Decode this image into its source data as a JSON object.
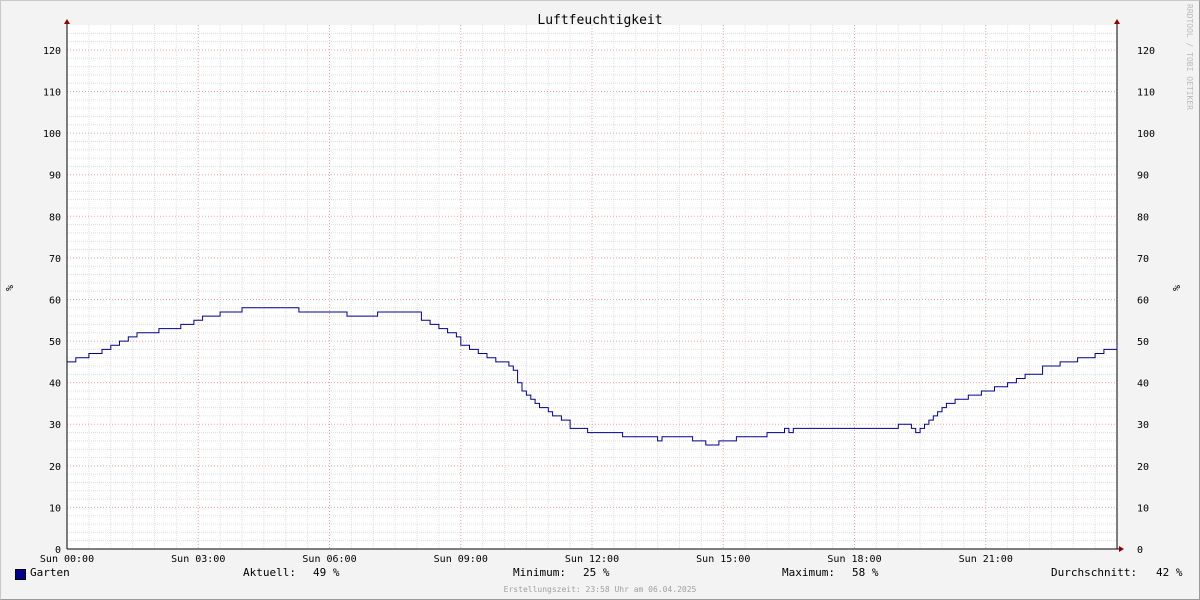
{
  "chart_data": {
    "type": "line",
    "title": "Luftfeuchtigkeit",
    "ylabel": "%",
    "ylim": [
      0,
      126
    ],
    "y_ticks": [
      0,
      10,
      20,
      30,
      40,
      50,
      60,
      70,
      80,
      90,
      100,
      110,
      120
    ],
    "x_range_hours": [
      0,
      24
    ],
    "x_tick_labels": [
      "Sun 00:00",
      "Sun 03:00",
      "Sun 06:00",
      "Sun 09:00",
      "Sun 12:00",
      "Sun 15:00",
      "Sun 18:00",
      "Sun 21:00"
    ],
    "grid": true,
    "series": [
      {
        "name": "Garten",
        "color": "#00008b",
        "hours": [
          0,
          0.2,
          0.5,
          0.8,
          1.0,
          1.2,
          1.4,
          1.6,
          1.8,
          2.1,
          2.6,
          2.9,
          3.1,
          3.5,
          3.8,
          4.0,
          5.3,
          6.4,
          7.1,
          8.0,
          8.1,
          8.3,
          8.5,
          8.7,
          8.9,
          9.0,
          9.2,
          9.4,
          9.6,
          9.8,
          10.1,
          10.2,
          10.3,
          10.4,
          10.5,
          10.6,
          10.7,
          10.8,
          11.0,
          11.1,
          11.3,
          11.5,
          11.9,
          12.3,
          12.7,
          13.5,
          13.6,
          13.7,
          14.3,
          14.6,
          14.9,
          15.3,
          16.0,
          16.3,
          16.4,
          16.5,
          16.6,
          17.0,
          18.0,
          19.0,
          19.3,
          19.4,
          19.5,
          19.6,
          19.7,
          19.8,
          19.9,
          20.0,
          20.1,
          20.3,
          20.6,
          20.9,
          21.2,
          21.5,
          21.7,
          21.9,
          22.3,
          22.7,
          23.1,
          23.5,
          23.7,
          24.0
        ],
        "values": [
          45,
          46,
          47,
          48,
          49,
          50,
          51,
          52,
          52,
          53,
          54,
          55,
          56,
          57,
          57,
          58,
          57,
          56,
          57,
          57,
          55,
          54,
          53,
          52,
          51,
          49,
          48,
          47,
          46,
          45,
          44,
          43,
          40,
          38,
          37,
          36,
          35,
          34,
          33,
          32,
          31,
          29,
          28,
          28,
          27,
          26,
          27,
          27,
          26,
          25,
          26,
          27,
          28,
          28,
          29,
          28,
          29,
          29,
          29,
          30,
          29,
          28,
          29,
          30,
          31,
          32,
          33,
          34,
          35,
          36,
          37,
          38,
          39,
          40,
          41,
          42,
          44,
          45,
          46,
          47,
          48,
          49
        ]
      }
    ]
  },
  "legend": {
    "series_name": "Garten",
    "current_label": "Aktuell:",
    "current_value": "49 %",
    "min_label": "Minimum:",
    "min_value": "25 %",
    "max_label": "Maximum:",
    "max_value": "58 %",
    "avg_label": "Durchschnitt:",
    "avg_value": "42 %"
  },
  "watermark": "RRDTOOL / TOBI OETIKER",
  "credit": "Erstellungszeit: 23:58 Uhr am 06.04.2025"
}
